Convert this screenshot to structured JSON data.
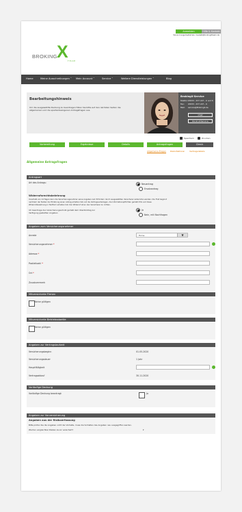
{
  "header": {
    "logo_main": "BROKING",
    "logo_x": "X",
    "logo_sub": "TEAM",
    "top_btn_left": "Anmelden",
    "top_btn_right": "Hilfe & Kontakt",
    "top_sub": "Sie sind angemeldet als: musteR@brokingXteam.de"
  },
  "nav": {
    "items": [
      "Home",
      "Meine Ausschreibungen ˅",
      "Mein Account ˅",
      "Service ˅",
      "Weitere Dienstleistungen ˅",
      "Blog"
    ]
  },
  "intro": {
    "title": "Bearbeitungshinweis",
    "text_line1": "Um die ausgewählte Deckung zu beantragen füllen Sie bitte auf den nächsten Seiten die",
    "text_line2": "allgemeinen und die spartenbezogenen Antragsfragen aus.",
    "service_title": "BrokingX-Service",
    "service_phone_label": "Telefon:",
    "service_phone": "03333 - 677 227 - 0 und 6",
    "service_fax_label": "Fax:",
    "service_fax": "03333 - 677 227 - 9",
    "service_mail_label": "Mail:",
    "service_mail": "service@BrokingX.de",
    "btn_chat": "Chat",
    "btn_callback": "Rückruf-Service"
  },
  "actions": {
    "save": "Speichern",
    "print": "Drucken"
  },
  "steps": {
    "items": [
      "Vorbereitung",
      "Ergebnisse",
      "Details",
      "Antragsfragen",
      "Check"
    ],
    "subs": [
      "Allgemeine Fragen",
      "Risikofaktoren",
      "Vertragsdetails"
    ]
  },
  "page_title": "Allgemeine Antragsfragen",
  "antragsart": {
    "head": "Antragsart",
    "label": "Art des Antrags:",
    "opt1": "Neuantrag",
    "opt2": "Ersatzantrag",
    "widerruf_title": "Widerrufsrechtsbelehrung",
    "widerruf_line1": "Innerhalb von 14 Tagen kann die Versicherungsnehmer seine Angaben zum Erfordern durch ausgewählten Versicherer widerrufen werden. Die Frist beginnt",
    "widerruf_line2": "nachdem der Nutzer der Erklärung einen Antrag erhalten hat und die Vertragsunterlagen, die Informationspflichten gemäß VVG und diese",
    "widerruf_line3": "Widerrufsbelehrung in Textform erhalten hat. Der Widerruf ist an den Versicherer zu richten.",
    "consent_line1": "Ich beantrage den Versicherungsschutz gemäß dem Uberblicktag zur",
    "consent_line2": "Verfügung gestellten Angaben",
    "consent_yes": "Ja",
    "consent_no": "Nein, mit Nachfragen"
  },
  "vn": {
    "head": "Angaben zum Versicherungsnehmer",
    "anrede_label": "Anrede",
    "anrede_value": "Firma",
    "name_label": "Versicherungsnehmer",
    "adresse_label": "Adresse",
    "plz_label": "Postleitzahl",
    "ort_label": "Ort",
    "zusatz_label": "Zusatzvermerk"
  },
  "mit_firmen": {
    "head": "Mitversicherte Firmen",
    "cb_label": "Keine gültigen"
  },
  "mit_betrieb": {
    "head": "Mitversicherte Betriebsstaette",
    "cb_label": "Keine gültigen"
  },
  "laufzeit": {
    "head": "Angaben zur Vertragslaufzeit",
    "beginn_label": "Versicherungsbeginn",
    "beginn_value": "01.05.2020",
    "dauer_label": "Versicherungsdauer",
    "dauer_value": "1 Jahr",
    "faellig_label": "Hauptfälligkeit",
    "ablauf_label": "Vertragsablauf",
    "ablauf_value": "30.11.2020"
  },
  "vorlaeufig": {
    "head": "Vorläufige Deckung",
    "label": "Vorläufige Deckung beantragt",
    "cb_label": "Ja"
  },
  "vorversicherung": {
    "head": "Angaben zur Vorversicherung",
    "sub": "Angaben aus der Risikoerfassung",
    "line": "Bitte prüfen Sie die Angaben nicht der Vorhalte, muss die Vorhalten des Angaben neu ausgegriffen werden.",
    "frage": "Wurden vergleichbar Risiken zuvor versichert?"
  },
  "colors": {
    "green": "#5cb82e",
    "dark": "#444444",
    "section": "#555555",
    "orange": "#e07b00"
  }
}
